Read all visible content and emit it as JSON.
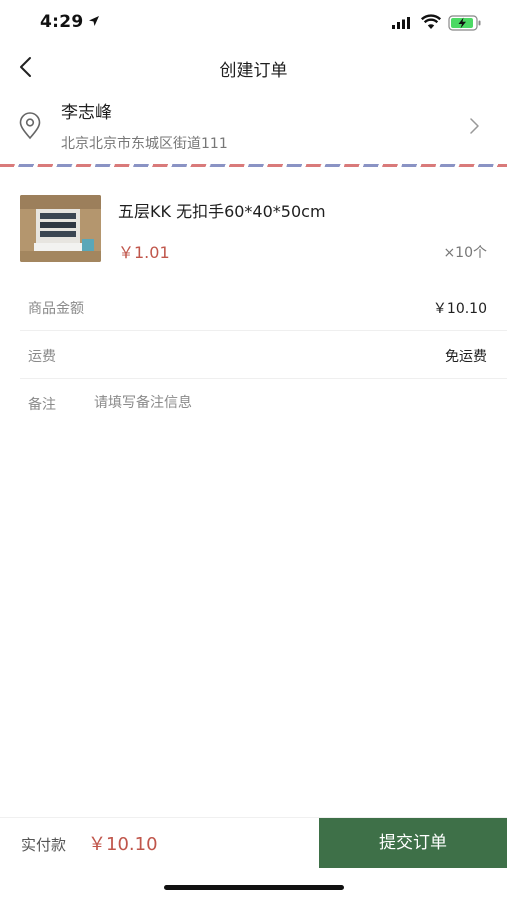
{
  "status_bar": {
    "time": "4:29"
  },
  "nav": {
    "title": "创建订单"
  },
  "address": {
    "name": "李志峰",
    "detail": "北京北京市东城区街道111"
  },
  "product": {
    "name": "五层KK 无扣手60*40*50cm",
    "price": "￥1.01",
    "quantity": "×10个"
  },
  "summary": {
    "goods_amount_label": "商品金额",
    "goods_amount_value": "￥10.10",
    "shipping_label": "运费",
    "shipping_value": "免运费",
    "remark_label": "备注",
    "remark_placeholder": "请填写备注信息",
    "remark_value": ""
  },
  "footer": {
    "pay_label": "实付款",
    "pay_amount": "￥10.10",
    "submit_label": "提交订单"
  },
  "colors": {
    "accent_green": "#3e7048",
    "price_red": "#c0564b"
  }
}
